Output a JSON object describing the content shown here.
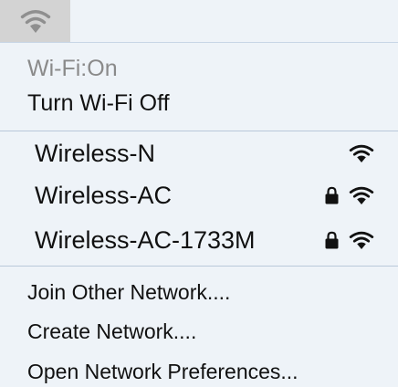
{
  "menubar": {
    "icon": "wifi-icon"
  },
  "menu": {
    "status_text": "Wi-Fi:On",
    "toggle_label": "Turn Wi-Fi Off",
    "networks": [
      {
        "name": "Wireless-N",
        "locked": false,
        "signal_icon": "wifi-icon"
      },
      {
        "name": "Wireless-AC",
        "locked": true,
        "signal_icon": "wifi-icon"
      },
      {
        "name": "Wireless-AC-1733M",
        "locked": true,
        "signal_icon": "wifi-icon"
      }
    ],
    "actions": [
      {
        "label": "Join Other Network...."
      },
      {
        "label": "Create Network...."
      },
      {
        "label": "Open Network Preferences..."
      }
    ]
  },
  "colors": {
    "menu_background": "#eef3f8",
    "menubar_icon_background": "#d3d3d3",
    "status_text": "#8a8a8a",
    "text": "#111111"
  }
}
